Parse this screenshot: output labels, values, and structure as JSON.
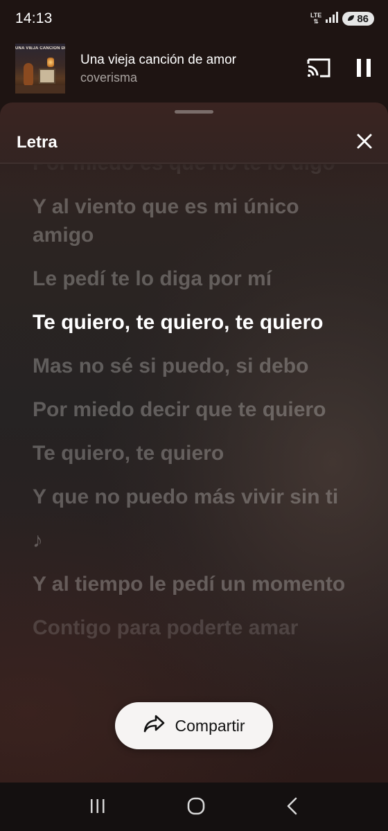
{
  "status_bar": {
    "time": "14:13",
    "network": "LTE",
    "battery": "86",
    "icons": [
      "signal-icon",
      "battery-icon"
    ]
  },
  "mini_player": {
    "album_art_text": "UNA VIEJA CANCIÓN DE AMOR",
    "title": "Una vieja canción de amor",
    "artist": "coverisma",
    "icons": [
      "cast-icon",
      "pause-icon"
    ]
  },
  "lyrics_sheet": {
    "title": "Letra",
    "close_icon": "close-icon",
    "lines": [
      {
        "text": "Por miedo es que no te lo digo",
        "state": "past"
      },
      {
        "text": "Y al viento que es mi único amigo",
        "state": "past"
      },
      {
        "text": "Le pedí te lo diga por mí",
        "state": "past"
      },
      {
        "text": "Te quiero, te quiero, te quiero",
        "state": "active"
      },
      {
        "text": "Mas no sé si puedo, si debo",
        "state": "upcoming"
      },
      {
        "text": "Por miedo decir que te quiero",
        "state": "upcoming"
      },
      {
        "text": "Te quiero, te quiero",
        "state": "upcoming"
      },
      {
        "text": "Y que no puedo más vivir sin ti",
        "state": "upcoming"
      },
      {
        "text": "♪",
        "state": "upcoming"
      },
      {
        "text": "Y al tiempo le pedí un momento",
        "state": "upcoming"
      },
      {
        "text": "Contigo para poderte amar",
        "state": "upcoming"
      }
    ],
    "share_button": {
      "label": "Compartir",
      "icon": "share-icon"
    }
  },
  "nav_bar": {
    "icons": [
      "recents-icon",
      "home-icon",
      "back-icon"
    ]
  },
  "colors": {
    "active_lyric": "#ffffff",
    "inactive_lyric": "#c8c4c2",
    "sheet_background": "#2a2222",
    "share_button_bg": "#f6f4f3"
  }
}
